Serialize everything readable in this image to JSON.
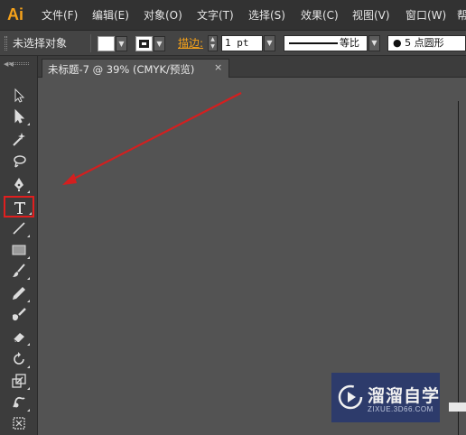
{
  "app": {
    "logo": "Ai"
  },
  "menu": [
    {
      "label": "文件(F)"
    },
    {
      "label": "编辑(E)"
    },
    {
      "label": "对象(O)"
    },
    {
      "label": "文字(T)"
    },
    {
      "label": "选择(S)"
    },
    {
      "label": "效果(C)"
    },
    {
      "label": "视图(V)"
    },
    {
      "label": "窗口(W)"
    },
    {
      "label": "帮"
    }
  ],
  "control": {
    "selection_label": "未选择对象",
    "fill_color": "#ffffff",
    "stroke_label": "描边:",
    "stroke_weight": "1 pt",
    "stroke_profile": "等比",
    "brush": "● 5 点圆形"
  },
  "tab": {
    "label": "未标题-7 @ 39% (CMYK/预览)",
    "close": "×"
  },
  "tools": [
    {
      "name": "selection-tool-icon"
    },
    {
      "name": "direct-selection-tool-icon"
    },
    {
      "name": "magic-wand-tool-icon"
    },
    {
      "name": "lasso-tool-icon"
    },
    {
      "name": "pen-tool-icon"
    },
    {
      "name": "type-tool-icon",
      "label": "T",
      "highlighted": true
    },
    {
      "name": "line-segment-tool-icon"
    },
    {
      "name": "rectangle-tool-icon"
    },
    {
      "name": "paintbrush-tool-icon"
    },
    {
      "name": "pencil-tool-icon"
    },
    {
      "name": "blob-brush-tool-icon"
    },
    {
      "name": "eraser-tool-icon"
    },
    {
      "name": "rotate-tool-icon"
    },
    {
      "name": "scale-tool-icon"
    },
    {
      "name": "warp-tool-icon"
    },
    {
      "name": "free-transform-tool-icon"
    }
  ],
  "colors": {
    "accent": "#f6a21a",
    "highlight": "#e01f1f",
    "canvas": "#535353"
  },
  "watermark": {
    "name": "溜溜自学",
    "url": "ZIXUE.3D66.COM"
  }
}
